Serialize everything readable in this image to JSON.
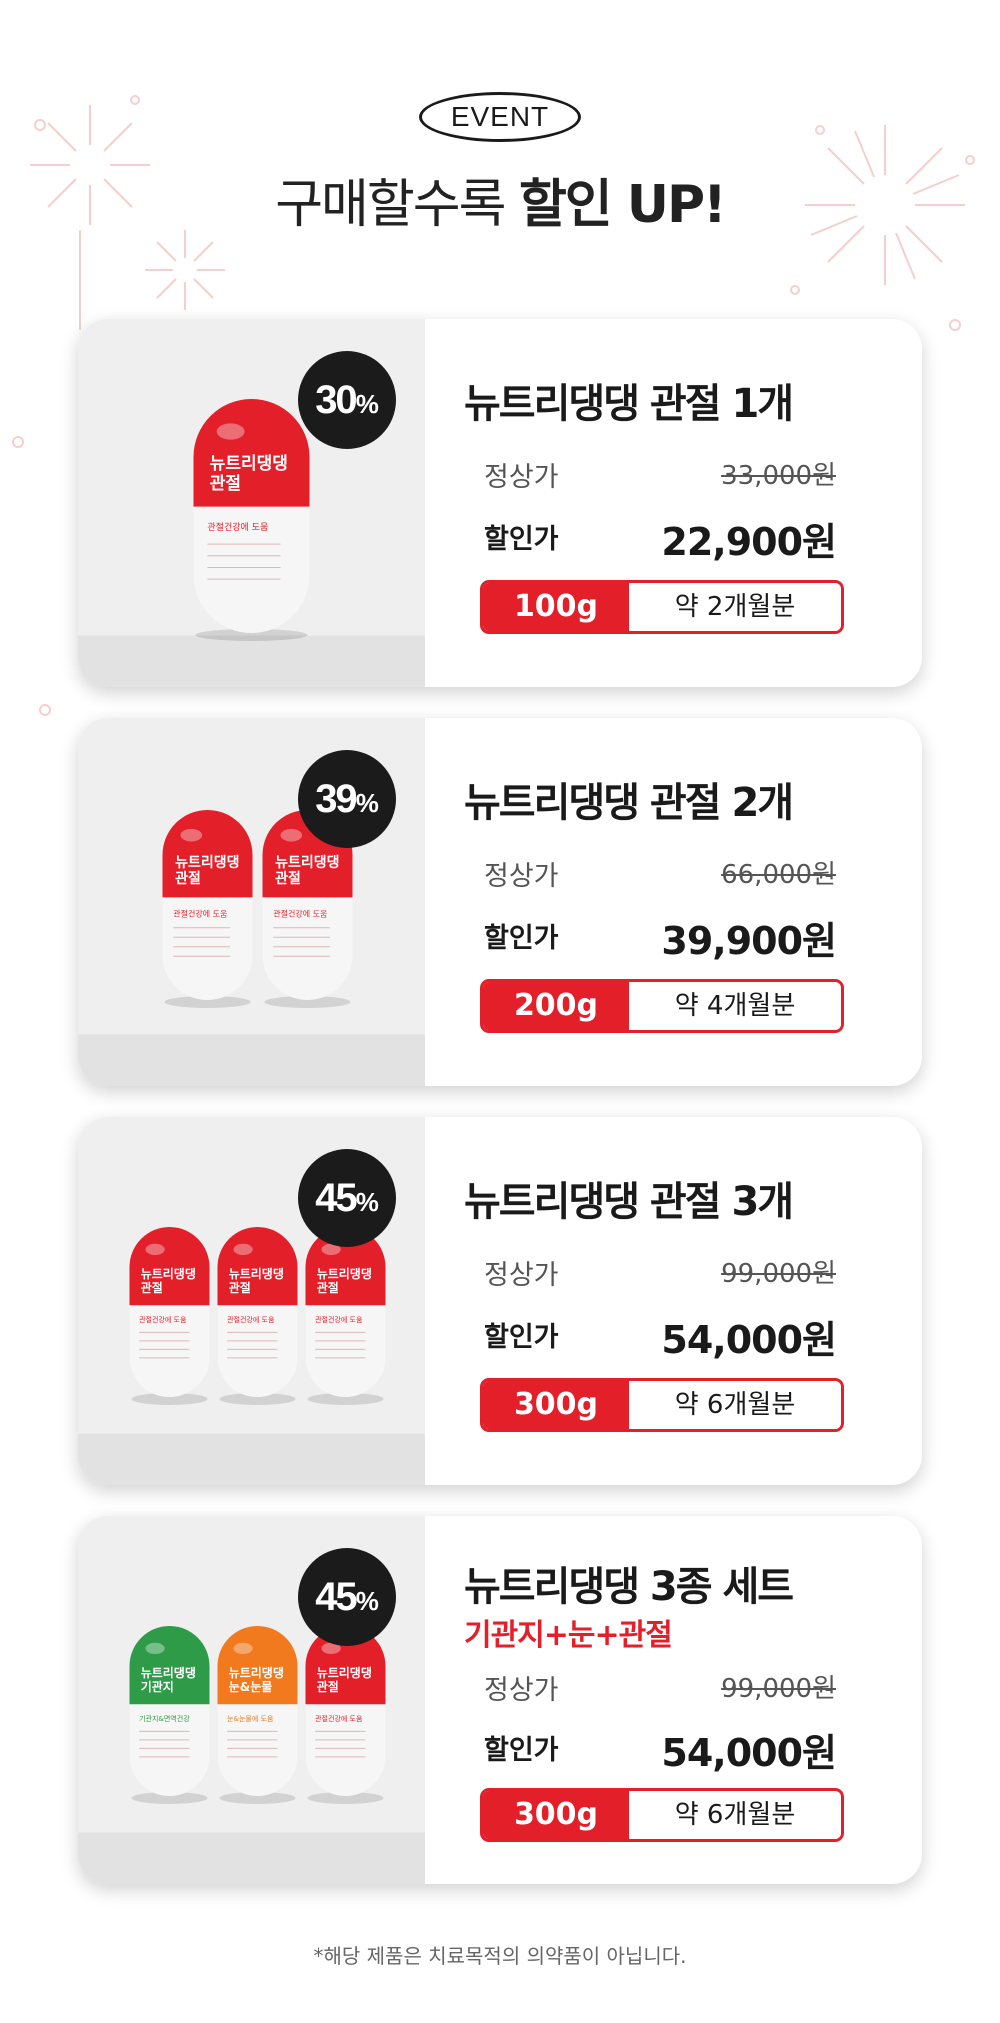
{
  "header": {
    "event_label": "EVENT",
    "headline_regular": "구매할수록",
    "headline_bold": "할인 UP!"
  },
  "colors": {
    "accent_red": "#e3202a",
    "badge_black": "#1b1b1b",
    "pill_green": "#2e9b48",
    "pill_orange": "#f07a1d"
  },
  "products": [
    {
      "discount_num": "30",
      "discount_unit": "%",
      "title": "뉴트리댕댕 관절 1개",
      "subtitle": "",
      "regular_label": "정상가",
      "regular_price": "33,000원",
      "sale_label": "할인가",
      "sale_price": "22,900원",
      "weight": "100g",
      "duration": "약 2개월분",
      "pills": [
        "red"
      ]
    },
    {
      "discount_num": "39",
      "discount_unit": "%",
      "title": "뉴트리댕댕 관절 2개",
      "subtitle": "",
      "regular_label": "정상가",
      "regular_price": "66,000원",
      "sale_label": "할인가",
      "sale_price": "39,900원",
      "weight": "200g",
      "duration": "약 4개월분",
      "pills": [
        "red",
        "red"
      ]
    },
    {
      "discount_num": "45",
      "discount_unit": "%",
      "title": "뉴트리댕댕 관절 3개",
      "subtitle": "",
      "regular_label": "정상가",
      "regular_price": "99,000원",
      "sale_label": "할인가",
      "sale_price": "54,000원",
      "weight": "300g",
      "duration": "약 6개월분",
      "pills": [
        "red",
        "red",
        "red"
      ]
    },
    {
      "discount_num": "45",
      "discount_unit": "%",
      "title": "뉴트리댕댕 3종 세트",
      "subtitle": "기관지+눈+관절",
      "regular_label": "정상가",
      "regular_price": "99,000원",
      "sale_label": "할인가",
      "sale_price": "54,000원",
      "weight": "300g",
      "duration": "약 6개월분",
      "pills": [
        "green",
        "orange",
        "red"
      ]
    }
  ],
  "pill_labels": {
    "brand": "뉴트리댕댕",
    "red": "관절",
    "green": "기관지",
    "orange": "눈&눈물",
    "red_band": "관절건강에 도움",
    "green_band": "기관지&면역건강",
    "orange_band": "눈&눈물에 도움"
  },
  "footnote": "*해당 제품은 치료목적의 의약품이 아닙니다."
}
